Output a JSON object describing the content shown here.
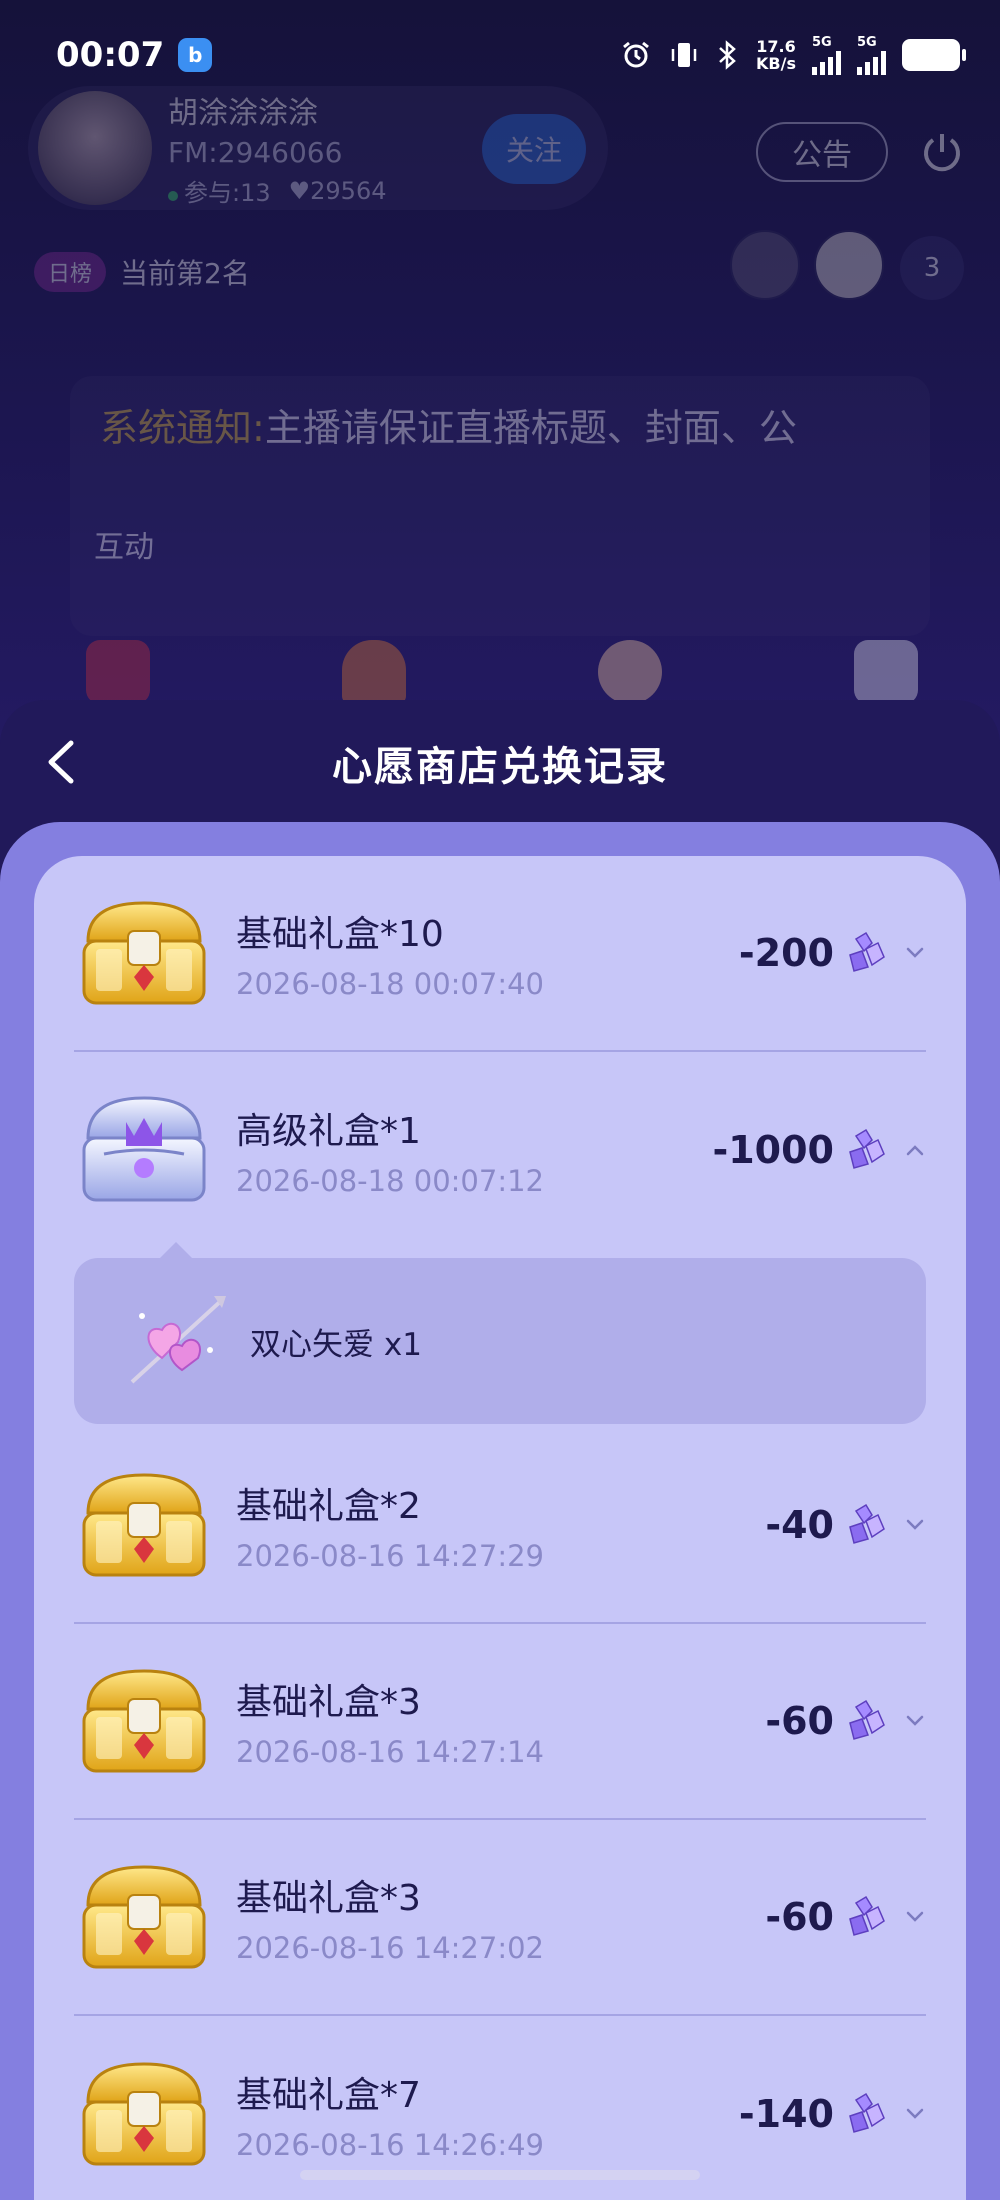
{
  "status_bar": {
    "time": "00:07",
    "net_speed_value": "17.6",
    "net_speed_unit": "KB/s",
    "sim1_label": "5G",
    "sim2_label": "5G"
  },
  "room": {
    "host_name": "胡涂涂涂涂",
    "host_fm": "FM:2946066",
    "participants": "参与:13",
    "likes": "29564",
    "follow_label": "关注",
    "notice_label": "公告",
    "rank_tag": "日榜",
    "rank_text": "当前第2名",
    "viewer_count": "3",
    "system_notice_label": "系统通知:",
    "system_notice_text": "主播请保证直播标题、封面、公",
    "interact_label": "互动"
  },
  "sheet": {
    "title": "心愿商店兑换记录"
  },
  "records": [
    {
      "name": "基础礼盒*10",
      "time": "2026-08-18 00:07:40",
      "amount": "-200",
      "chest": "gold",
      "expanded": false
    },
    {
      "name": "高级礼盒*1",
      "time": "2026-08-18 00:07:12",
      "amount": "-1000",
      "chest": "silver",
      "expanded": true,
      "details": [
        {
          "name": "双心矢爱 x1"
        }
      ]
    },
    {
      "name": "基础礼盒*2",
      "time": "2026-08-16 14:27:29",
      "amount": "-40",
      "chest": "gold",
      "expanded": false
    },
    {
      "name": "基础礼盒*3",
      "time": "2026-08-16 14:27:14",
      "amount": "-60",
      "chest": "gold",
      "expanded": false
    },
    {
      "name": "基础礼盒*3",
      "time": "2026-08-16 14:27:02",
      "amount": "-60",
      "chest": "gold",
      "expanded": false
    },
    {
      "name": "基础礼盒*7",
      "time": "2026-08-16 14:26:49",
      "amount": "-140",
      "chest": "gold",
      "expanded": false
    }
  ],
  "colors": {
    "accent": "#847fe0",
    "card": "#c7c6f8",
    "text_dark": "#1e1a4e",
    "text_muted": "#8a89c8"
  }
}
